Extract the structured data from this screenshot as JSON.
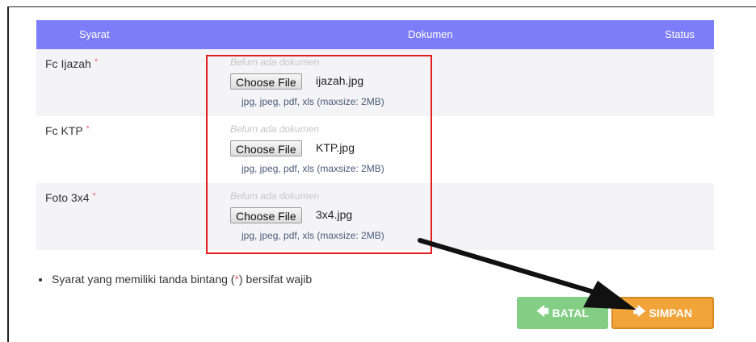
{
  "table": {
    "headers": {
      "syarat": "Syarat",
      "dokumen": "Dokumen",
      "status": "Status"
    },
    "rows": [
      {
        "label": "Fc Ijazah",
        "star": "*",
        "empty": "Belum ada dokumen",
        "button": "Choose File",
        "file": "ijazah.jpg",
        "hint": "jpg, jpeg, pdf, xls (maxsize: 2MB)"
      },
      {
        "label": "Fc KTP",
        "star": "*",
        "empty": "Belum ada dokumen",
        "button": "Choose File",
        "file": "KTP.jpg",
        "hint": "jpg, jpeg, pdf, xls (maxsize: 2MB)"
      },
      {
        "label": "Foto 3x4",
        "star": "*",
        "empty": "Belum ada dokumen",
        "button": "Choose File",
        "file": "3x4.jpg",
        "hint": "jpg, jpeg, pdf, xls (maxsize: 2MB)"
      }
    ]
  },
  "note": {
    "before": "Syarat yang memiliki tanda bintang (",
    "star": "*",
    "after": ") bersifat wajib"
  },
  "buttons": {
    "batal": "BATAL",
    "simpan": "SIMPAN"
  },
  "colors": {
    "header": "#7d7dfa",
    "batal": "#82ce84",
    "simpan": "#f0a43a",
    "highlight_box": "#e02020",
    "required_star": "#e6707b"
  },
  "icons": {
    "batal": "arrow-left-icon",
    "simpan": "arrow-right-icon"
  }
}
